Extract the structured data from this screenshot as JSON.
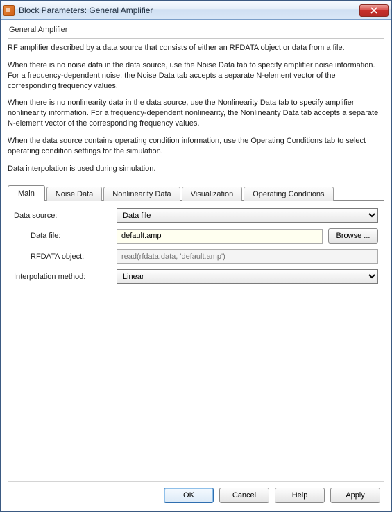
{
  "window": {
    "title": "Block Parameters: General Amplifier"
  },
  "group": {
    "title": "General Amplifier"
  },
  "description": {
    "p1": "RF amplifier described by a data source that consists of either an RFDATA object or data from a file.",
    "p2": "When there is no noise data in the data source, use the Noise Data tab to specify amplifier noise information. For a frequency-dependent noise, the Noise Data tab accepts a separate N-element vector of the corresponding frequency values.",
    "p3": "When there is no nonlinearity data in the data source, use the Nonlinearity Data tab to specify amplifier nonlinearity information. For a frequency-dependent nonlinearity, the Nonlinearity Data tab accepts a separate N-element vector of the corresponding frequency values.",
    "p4": "When the data source contains operating condition information, use the Operating Conditions tab to select operating condition settings for the simulation.",
    "p5": "Data interpolation is used during simulation."
  },
  "tabs": {
    "main": "Main",
    "noise": "Noise Data",
    "nonlin": "Nonlinearity Data",
    "viz": "Visualization",
    "opcond": "Operating Conditions"
  },
  "form": {
    "dataSourceLabel": "Data source:",
    "dataSourceValue": "Data file",
    "dataFileLabel": "Data file:",
    "dataFileValue": "default.amp",
    "browseLabel": "Browse ...",
    "rfdataLabel": "RFDATA object:",
    "rfdataPlaceholder": "read(rfdata.data, 'default.amp')",
    "interpLabel": "Interpolation method:",
    "interpValue": "Linear"
  },
  "buttons": {
    "ok": "OK",
    "cancel": "Cancel",
    "help": "Help",
    "apply": "Apply"
  }
}
